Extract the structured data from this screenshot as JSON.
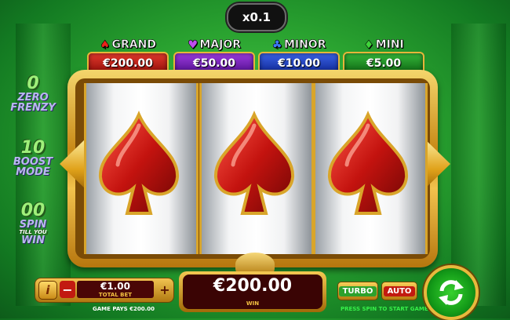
{
  "multiplier": "x0.1",
  "jackpots": [
    {
      "name": "GRAND",
      "amount": "€200.00",
      "icon": "spade-icon",
      "color": "#c81e14"
    },
    {
      "name": "MAJOR",
      "amount": "€50.00",
      "icon": "heart-icon",
      "color": "#7b22c4"
    },
    {
      "name": "MINOR",
      "amount": "€10.00",
      "icon": "club-icon",
      "color": "#1a3fc4"
    },
    {
      "name": "MINI",
      "amount": "€5.00",
      "icon": "diamond-icon",
      "color": "#1f8f25"
    }
  ],
  "features": [
    {
      "number": "0",
      "line1": "ZERO",
      "line2": "FRENZY"
    },
    {
      "number": "10",
      "line1": "BOOST",
      "line2": "MODE"
    },
    {
      "number": "00",
      "line1": "SPIN",
      "line2": "WIN",
      "small": "TILL YOU"
    }
  ],
  "reels": [
    "spade",
    "spade",
    "spade"
  ],
  "controls": {
    "info_label": "i",
    "minus_label": "−",
    "plus_label": "+",
    "bet_value": "€1.00",
    "bet_label": "TOTAL BET",
    "game_pays": "GAME PAYS €200.00",
    "win_value": "€200.00",
    "win_label": "WIN",
    "turbo_label": "TURBO",
    "auto_label": "AUTO",
    "press_spin": "PRESS SPIN TO START GAME"
  },
  "colors": {
    "accent_gold": "#e7b53a",
    "background_green": "#2aa330",
    "symbol_red": "#b3110e"
  }
}
